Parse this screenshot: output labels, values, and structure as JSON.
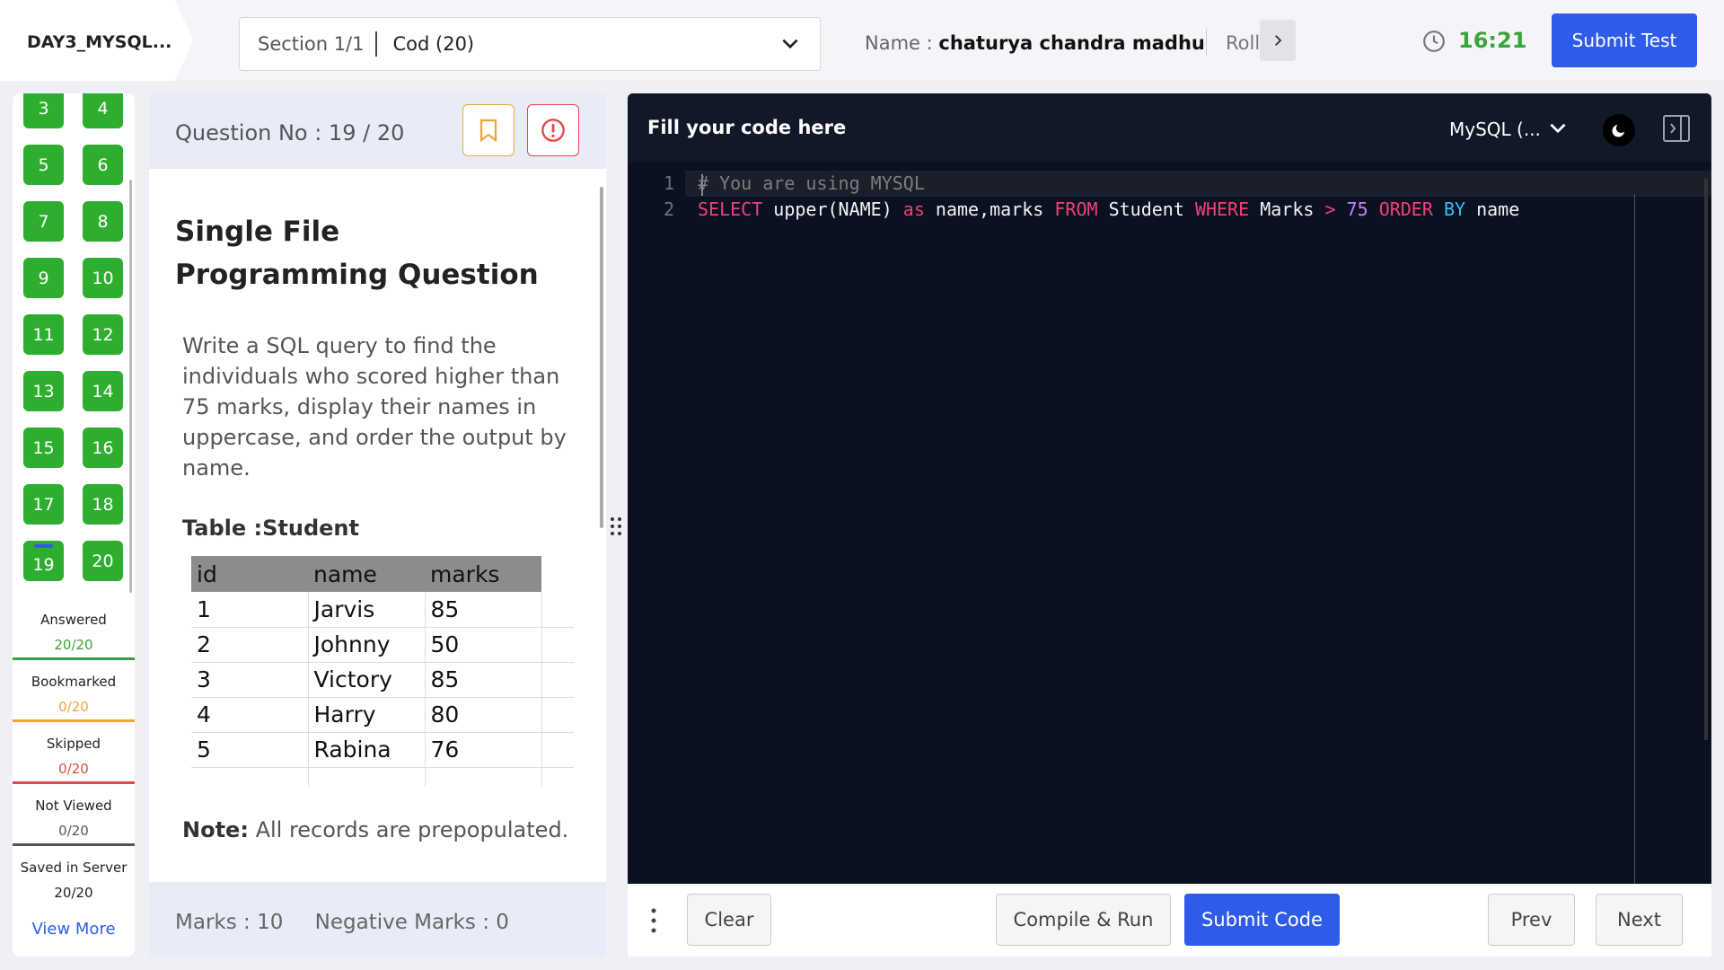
{
  "header": {
    "test_title": "DAY3_MYSQL...",
    "section_label": "Section 1/1",
    "section_name": "Cod (20)",
    "name_label": "Name :",
    "name_value": "chaturya chandra madhu",
    "roll_label": "Roll",
    "timer": "16:21",
    "submit_test": "Submit Test"
  },
  "palette": {
    "questions": [
      "3",
      "4",
      "5",
      "6",
      "7",
      "8",
      "9",
      "10",
      "11",
      "12",
      "13",
      "14",
      "15",
      "16",
      "17",
      "18",
      "19",
      "20"
    ],
    "current": "19",
    "answered_color": "#2eae2e"
  },
  "stats": {
    "answered": {
      "label": "Answered",
      "value": "20/20",
      "color": "#3aa33a"
    },
    "bookmarked": {
      "label": "Bookmarked",
      "value": "0/20",
      "color": "#f0a53a"
    },
    "skipped": {
      "label": "Skipped",
      "value": "0/20",
      "color": "#e04848"
    },
    "not_viewed": {
      "label": "Not Viewed",
      "value": "0/20",
      "color": "#555555"
    },
    "saved": {
      "label": "Saved in Server",
      "value": "20/20",
      "color": "#222222"
    }
  },
  "view_more": "View More",
  "question": {
    "number_label": "Question No : 19 / 20",
    "title": "Single File Programming Question",
    "text": "Write a SQL query to find the individuals who scored higher than 75 marks, display their names in uppercase, and order the output by name.",
    "table_label": "Table :Student",
    "table": {
      "headers": [
        "id",
        "name",
        "marks"
      ],
      "rows": [
        [
          "1",
          "Jarvis",
          "85"
        ],
        [
          "2",
          "Johnny",
          "50"
        ],
        [
          "3",
          "Victory",
          "85"
        ],
        [
          "4",
          "Harry",
          "80"
        ],
        [
          "5",
          "Rabina",
          "76"
        ]
      ]
    },
    "note_label": "Note:",
    "note_text": "All records are prepopulated.",
    "marks": "Marks : 10",
    "negative_marks": "Negative Marks : 0"
  },
  "editor": {
    "title": "Fill your code here",
    "language": "MySQL (...",
    "line_numbers": [
      "1",
      "2"
    ]
  },
  "footer": {
    "clear": "Clear",
    "compile_run": "Compile & Run",
    "submit_code": "Submit Code",
    "prev": "Prev",
    "next": "Next"
  },
  "colors": {
    "primary": "#2f5bea",
    "timer": "#3aa33a",
    "editor_bg": "#0b1120"
  }
}
